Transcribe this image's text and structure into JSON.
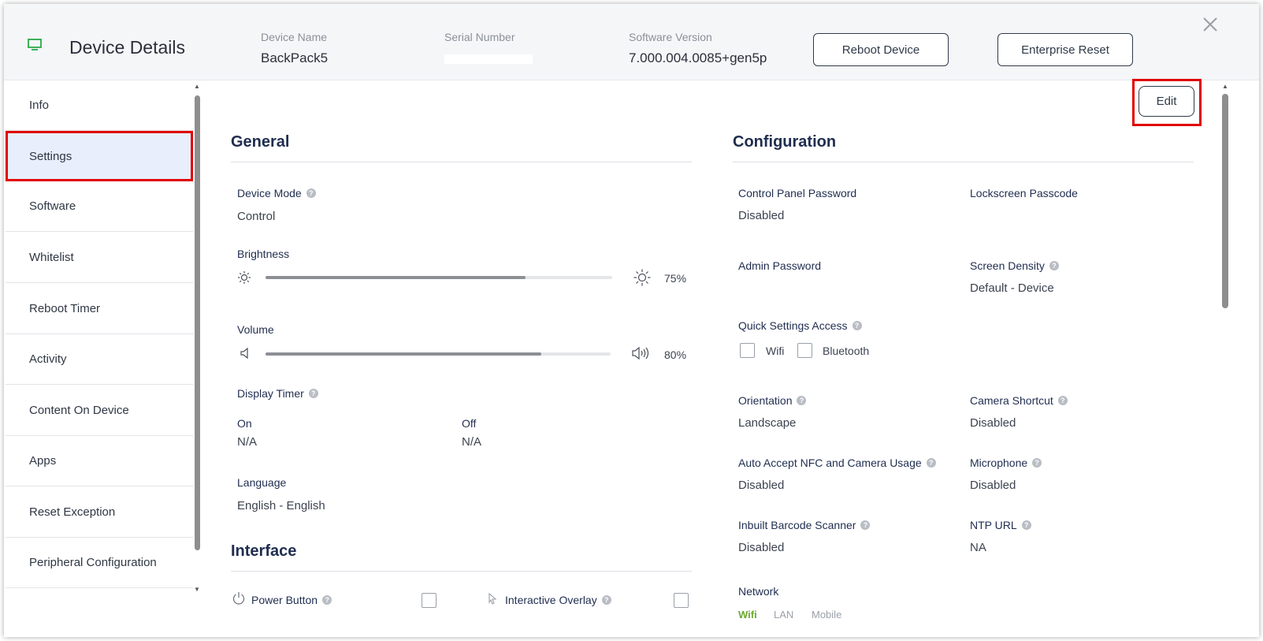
{
  "header": {
    "title": "Device Details",
    "device_name_label": "Device Name",
    "device_name": "BackPack5",
    "serial_label": "Serial Number",
    "software_label": "Software Version",
    "software_version": "7.000.004.0085+gen5p",
    "reboot_button": "Reboot Device",
    "enterprise_reset_button": "Enterprise Reset",
    "icon": "monitor-icon",
    "close_icon": "close-icon"
  },
  "sidebar": {
    "items": [
      {
        "label": "Info"
      },
      {
        "label": "Settings",
        "active": true
      },
      {
        "label": "Software"
      },
      {
        "label": "Whitelist"
      },
      {
        "label": "Reboot Timer"
      },
      {
        "label": "Activity"
      },
      {
        "label": "Content On Device"
      },
      {
        "label": "Apps"
      },
      {
        "label": "Reset Exception"
      },
      {
        "label": "Peripheral Configuration"
      }
    ]
  },
  "main": {
    "edit_button": "Edit",
    "general": {
      "title": "General",
      "device_mode_label": "Device Mode",
      "device_mode_value": "Control",
      "brightness_label": "Brightness",
      "brightness_value": "75%",
      "brightness_level": 0.75,
      "volume_label": "Volume",
      "volume_value": "80%",
      "volume_level": 0.8,
      "display_timer_label": "Display Timer",
      "on_label": "On",
      "on_value": "N/A",
      "off_label": "Off",
      "off_value": "N/A",
      "language_label": "Language",
      "language_value": "English - English"
    },
    "interface": {
      "title": "Interface",
      "power_button_label": "Power Button",
      "interactive_overlay_label": "Interactive Overlay"
    },
    "configuration": {
      "title": "Configuration",
      "control_panel_password_label": "Control Panel Password",
      "control_panel_password_value": "Disabled",
      "lockscreen_passcode_label": "Lockscreen Passcode",
      "admin_password_label": "Admin Password",
      "screen_density_label": "Screen Density",
      "screen_density_value": "Default - Device",
      "quick_settings_label": "Quick Settings Access",
      "wifi_option": "Wifi",
      "bluetooth_option": "Bluetooth",
      "orientation_label": "Orientation",
      "orientation_value": "Landscape",
      "camera_shortcut_label": "Camera Shortcut",
      "camera_shortcut_value": "Disabled",
      "auto_accept_label": "Auto Accept NFC and Camera Usage",
      "auto_accept_value": "Disabled",
      "microphone_label": "Microphone",
      "microphone_value": "Disabled",
      "barcode_label": "Inbuilt Barcode Scanner",
      "barcode_value": "Disabled",
      "ntp_label": "NTP URL",
      "ntp_value": "NA",
      "network_label": "Network",
      "network_tabs": [
        "Wifi",
        "LAN",
        "Mobile"
      ]
    }
  },
  "colors": {
    "accent_title": "#1f2d4f",
    "highlight": "#e00000",
    "active_tab": "#6aab2c",
    "monitor_icon": "#2aa84a"
  }
}
